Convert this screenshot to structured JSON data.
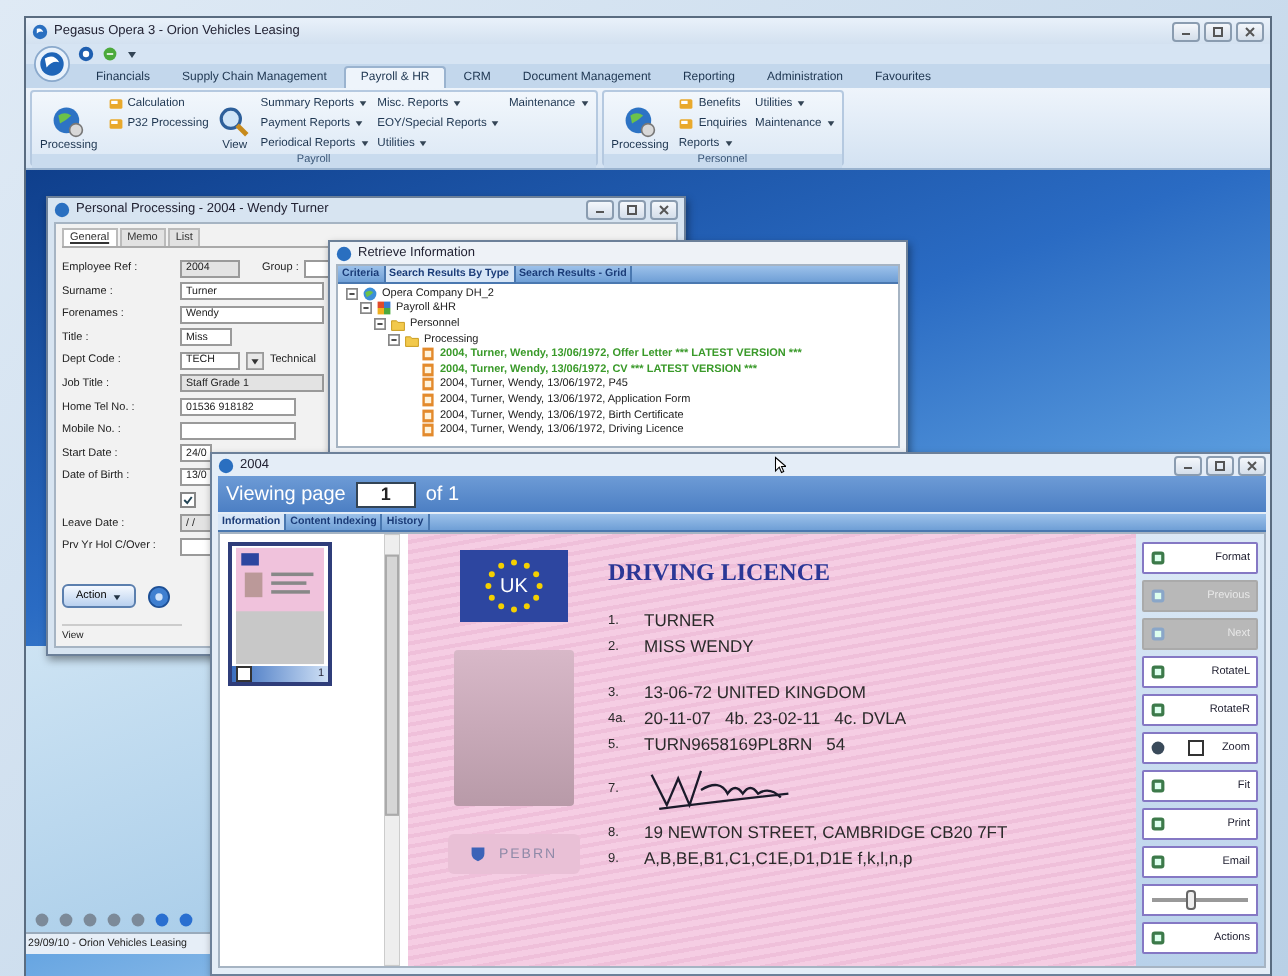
{
  "app": {
    "title": "Pegasus Opera 3 - Orion Vehicles Leasing",
    "status": "29/09/10 - Orion Vehicles Leasing"
  },
  "ribbon": {
    "tabs": [
      {
        "label": "Financials",
        "selected": false
      },
      {
        "label": "Supply Chain Management",
        "selected": false
      },
      {
        "label": "Payroll & HR",
        "selected": true
      },
      {
        "label": "CRM",
        "selected": false
      },
      {
        "label": "Document Management",
        "selected": false
      },
      {
        "label": "Reporting",
        "selected": false
      },
      {
        "label": "Administration",
        "selected": false
      },
      {
        "label": "Favourites",
        "selected": false
      }
    ],
    "groups": [
      {
        "label": "Payroll",
        "parts": [
          {
            "kind": "large",
            "label": "Processing"
          },
          {
            "kind": "column",
            "items": [
              {
                "kind": "command",
                "label": "Calculation"
              },
              {
                "kind": "command",
                "label": "P32 Processing"
              }
            ]
          },
          {
            "kind": "large-view",
            "label": "View"
          },
          {
            "kind": "column",
            "items": [
              {
                "kind": "menu",
                "label": "Summary Reports"
              },
              {
                "kind": "menu",
                "label": "Payment Reports"
              },
              {
                "kind": "menu",
                "label": "Periodical Reports"
              }
            ]
          },
          {
            "kind": "column",
            "items": [
              {
                "kind": "menu",
                "label": "Misc. Reports"
              },
              {
                "kind": "menu",
                "label": "EOY/Special Reports"
              },
              {
                "kind": "menu",
                "label": "Utilities"
              }
            ]
          },
          {
            "kind": "column",
            "items": [
              {
                "kind": "menu",
                "label": "Maintenance"
              }
            ]
          }
        ]
      },
      {
        "label": "Personnel",
        "parts": [
          {
            "kind": "large",
            "label": "Processing"
          },
          {
            "kind": "column",
            "items": [
              {
                "kind": "command",
                "label": "Benefits"
              },
              {
                "kind": "command",
                "label": "Enquiries"
              },
              {
                "kind": "menu",
                "label": "Reports"
              }
            ]
          },
          {
            "kind": "column",
            "items": [
              {
                "kind": "menu",
                "label": "Utilities"
              },
              {
                "kind": "menu",
                "label": "Maintenance"
              }
            ]
          }
        ]
      }
    ]
  },
  "personnel_window": {
    "title": "Personal Processing - 2004 - Wendy Turner",
    "tabs": [
      {
        "label": "General",
        "selected": true
      },
      {
        "label": "Memo",
        "selected": false
      },
      {
        "label": "List",
        "selected": false
      }
    ],
    "fields": [
      {
        "kind": "readonly",
        "label": "Employee Ref :",
        "value": "2004",
        "side_label": "Group :"
      },
      {
        "kind": "text",
        "label": "Surname :",
        "value": "Turner"
      },
      {
        "kind": "text",
        "label": "Forenames :",
        "value": "Wendy"
      },
      {
        "kind": "text",
        "label": "Title :",
        "value": "Miss"
      },
      {
        "kind": "dropdown",
        "label": "Dept Code :",
        "value": "TECH",
        "note": "Technical"
      },
      {
        "kind": "readonly",
        "label": "Job Title :",
        "value": "Staff Grade 1"
      },
      {
        "kind": "text",
        "label": "Home Tel No. :",
        "value": "01536 918182"
      },
      {
        "kind": "text",
        "label": "Mobile No. :"
      },
      {
        "kind": "text",
        "label": "Start Date :",
        "value": "24/0"
      },
      {
        "kind": "text",
        "label": "Date of Birth :",
        "value": "13/0"
      },
      {
        "kind": "checkbox",
        "checked": true
      },
      {
        "kind": "readonly",
        "label": "Leave Date :",
        "value": "/ /"
      },
      {
        "kind": "text",
        "label": "Prv Yr Hol C/Over :"
      }
    ],
    "action_button": "Action",
    "status": "View"
  },
  "retrieve_window": {
    "title": "Retrieve Information",
    "tabs": [
      {
        "label": "Criteria",
        "selected": false
      },
      {
        "label": "Search Results By Type",
        "selected": true
      },
      {
        "label": "Search Results - Grid",
        "selected": false
      }
    ],
    "tree": [
      {
        "kind": "company",
        "label": "Opera Company DH_2",
        "expanded": true,
        "children": [
          {
            "kind": "module",
            "label": "Payroll &HR",
            "expanded": true,
            "children": [
              {
                "kind": "folder",
                "label": "Personnel",
                "expanded": true,
                "children": [
                  {
                    "kind": "folder",
                    "label": "Processing",
                    "expanded": true,
                    "children": [
                      {
                        "kind": "document",
                        "label": "2004, Turner, Wendy, 13/06/1972, Offer Letter *** LATEST VERSION ***",
                        "latest": true
                      },
                      {
                        "kind": "document",
                        "label": "2004, Turner, Wendy, 13/06/1972, CV *** LATEST VERSION ***",
                        "latest": true
                      },
                      {
                        "kind": "document",
                        "label": "2004, Turner, Wendy, 13/06/1972, P45",
                        "latest": false
                      },
                      {
                        "kind": "document",
                        "label": "2004, Turner, Wendy, 13/06/1972, Application Form",
                        "latest": false
                      },
                      {
                        "kind": "document",
                        "label": "2004, Turner, Wendy, 13/06/1972, Birth Certificate",
                        "latest": false
                      },
                      {
                        "kind": "document",
                        "label": "2004, Turner, Wendy, 13/06/1972, Driving Licence",
                        "latest": false
                      }
                    ]
                  }
                ]
              }
            ]
          }
        ]
      }
    ]
  },
  "viewer_window": {
    "title": "2004",
    "viewing_label": "Viewing page",
    "page": "1",
    "page_total": "of 1",
    "tabs": [
      {
        "label": "Information",
        "selected": true
      },
      {
        "label": "Content Indexing",
        "selected": false
      },
      {
        "label": "History",
        "selected": false
      }
    ],
    "thumbnails": [
      {
        "page": "1",
        "checked": false,
        "selected": true
      }
    ],
    "licence": {
      "flag_text": "UK",
      "heading": "DRIVING LICENCE",
      "hologram_text": "PEBRN",
      "lines": [
        {
          "kind": "text",
          "number": "1.",
          "text": "TURNER"
        },
        {
          "kind": "text",
          "number": "2.",
          "text": "MISS WENDY"
        },
        {
          "kind": "text",
          "number": "3.",
          "text": "13-06-72 UNITED KINGDOM"
        },
        {
          "kind": "text",
          "number": "4a.",
          "text": "20-11-07   4b. 23-02-11   4c. DVLA"
        },
        {
          "kind": "text",
          "number": "5.",
          "text": "TURN9658169PL8RN   54"
        },
        {
          "kind": "signature",
          "number": "7."
        },
        {
          "kind": "text",
          "number": "8.",
          "text": "19 NEWTON STREET, CAMBRIDGE CB20 7FT"
        },
        {
          "kind": "text",
          "number": "9.",
          "text": "A,B,BE,B1,C1,C1E,D1,D1E f,k,l,n,p"
        }
      ]
    },
    "tools": [
      {
        "kind": "button",
        "label": "Format",
        "disabled": false
      },
      {
        "kind": "button",
        "label": "Previous",
        "disabled": true
      },
      {
        "kind": "button",
        "label": "Next",
        "disabled": true
      },
      {
        "kind": "button",
        "label": "RotateL",
        "disabled": false
      },
      {
        "kind": "button",
        "label": "RotateR",
        "disabled": false
      },
      {
        "kind": "toggle",
        "label": "Zoom",
        "checked": false
      },
      {
        "kind": "button",
        "label": "Fit",
        "disabled": false
      },
      {
        "kind": "button",
        "label": "Print",
        "disabled": false
      },
      {
        "kind": "button",
        "label": "Email",
        "disabled": false
      },
      {
        "kind": "slider",
        "level": 0.4
      },
      {
        "kind": "button",
        "label": "Actions",
        "disabled": false
      }
    ]
  }
}
